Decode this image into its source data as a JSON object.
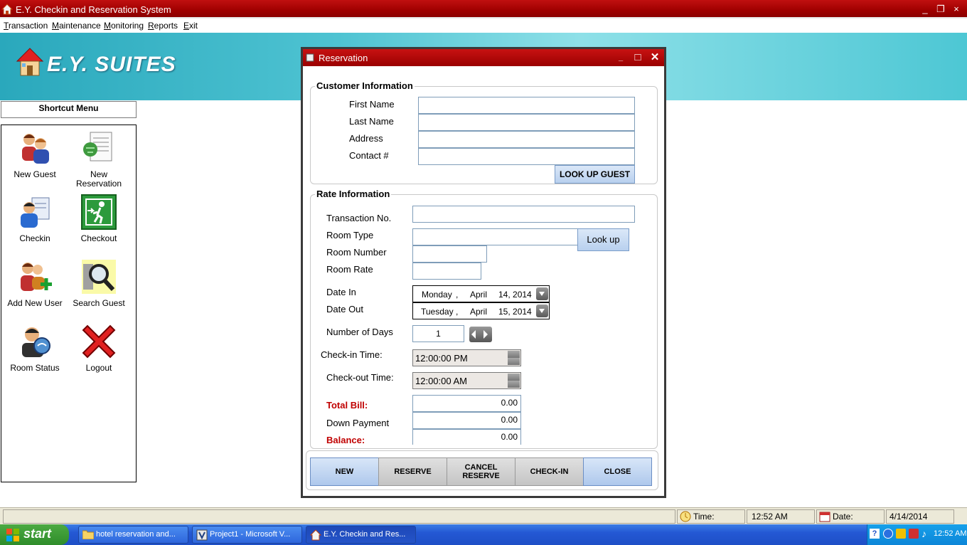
{
  "window": {
    "title": "E.Y. Checkin and Reservation System",
    "min": "_",
    "restore": "❐",
    "close": "×"
  },
  "menu": [
    "Transaction",
    "Maintenance",
    "Monitoring",
    "Reports",
    "Exit"
  ],
  "banner": {
    "logo_text": "E.Y. SUITES"
  },
  "shortcut": {
    "title": "Shortcut Menu",
    "items": [
      {
        "label": "New Guest",
        "icon": "guests-icon"
      },
      {
        "label": "New Reservation",
        "icon": "reservation-doc-icon"
      },
      {
        "label": "Checkin",
        "icon": "checkin-icon"
      },
      {
        "label": "Checkout",
        "icon": "exit-door-icon"
      },
      {
        "label": "Add New User",
        "icon": "add-user-icon"
      },
      {
        "label": "Search Guest",
        "icon": "magnifier-icon"
      },
      {
        "label": "Room Status",
        "icon": "room-status-icon"
      },
      {
        "label": "Logout",
        "icon": "logout-x-icon"
      }
    ]
  },
  "dialog": {
    "title": "Reservation",
    "customer": {
      "legend": "Customer Information",
      "first_name_label": "First Name",
      "last_name_label": "Last Name",
      "address_label": "Address",
      "contact_label": "Contact #",
      "first_name": "",
      "last_name": "",
      "address": "",
      "contact": "",
      "lookup_button": "LOOK UP GUEST"
    },
    "rate": {
      "legend": "Rate Information",
      "transaction_label": "Transaction No.",
      "room_type_label": "Room Type",
      "room_number_label": "Room Number",
      "room_rate_label": "Room Rate",
      "lookup_button": "Look up",
      "date_in_label": "Date In",
      "date_out_label": "Date Out",
      "date_in": {
        "weekday": "Monday",
        "month": "April",
        "day_year": "14, 2014"
      },
      "date_out": {
        "weekday": "Tuesday",
        "month": "April",
        "day_year": "15, 2014"
      },
      "days_label": "Number of Days",
      "days_value": "1",
      "checkin_time_label": "Check-in Time:",
      "checkin_time": "12:00:00 PM",
      "checkout_time_label": "Check-out Time:",
      "checkout_time": "12:00:00 AM",
      "total_label": "Total Bill:",
      "total_value": "0.00",
      "down_label": "Down Payment",
      "down_value": "0.00",
      "balance_label": "Balance:",
      "balance_value": "0.00"
    },
    "actions": {
      "new": "NEW",
      "reserve": "RESERVE",
      "cancel_1": "CANCEL",
      "cancel_2": "RESERVE",
      "checkin": "CHECK-IN",
      "close": "CLOSE"
    }
  },
  "status": {
    "time_label": "Time:",
    "time_value": "12:52 AM",
    "date_label": "Date:",
    "date_value": "4/14/2014"
  },
  "taskbar": {
    "start": "start",
    "tasks": [
      "hotel reservation and...",
      "Project1 - Microsoft V...",
      "E.Y. Checkin and Res..."
    ],
    "clock": "12:52 AM"
  },
  "colors": {
    "title_red": "#a00000",
    "banner_teal": "#4ec3d2",
    "xp_blue": "#2458d4",
    "balance_red": "#c00000"
  }
}
